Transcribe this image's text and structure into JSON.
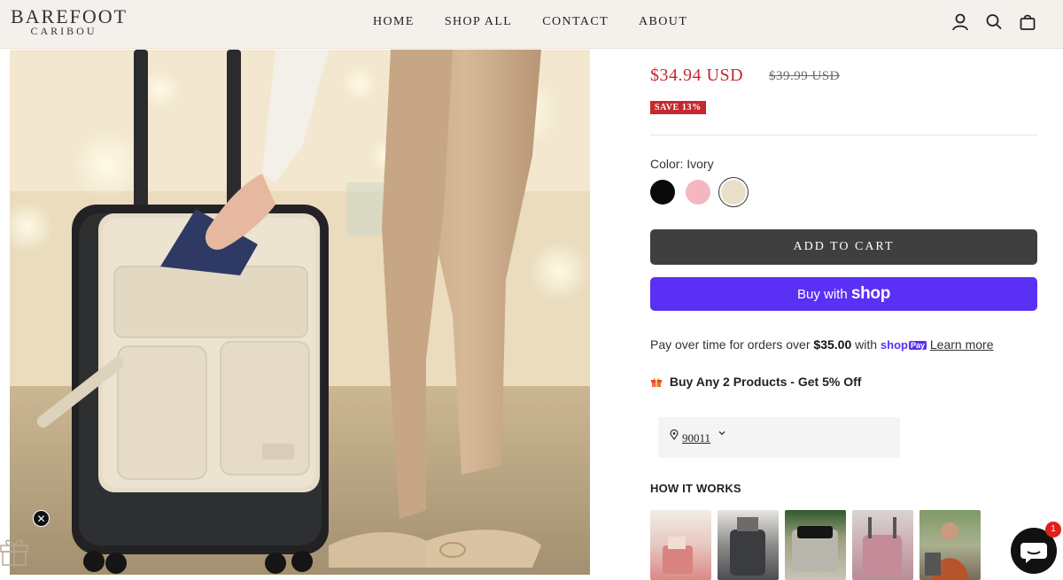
{
  "brand": {
    "line1": "BAREFOOT",
    "line2": "CARIBOU"
  },
  "nav": {
    "home": "HOME",
    "shop_all": "SHOP ALL",
    "contact": "CONTACT",
    "about": "ABOUT"
  },
  "product": {
    "price": "$34.94 USD",
    "compare_price": "$39.99 USD",
    "save_badge": "SAVE 13%",
    "color_label": "Color: Ivory",
    "swatches": [
      {
        "name": "Black",
        "color": "#0a0a0a"
      },
      {
        "name": "Pink",
        "color": "#f4b7c1"
      },
      {
        "name": "Ivory",
        "color": "#e9dfc8"
      }
    ],
    "selected_swatch": "Ivory",
    "add_to_cart": "ADD TO CART",
    "buy_with": "Buy with",
    "buy_with_brand": "shop"
  },
  "installments": {
    "prefix": "Pay over time for orders over",
    "amount": "$35.00",
    "with": "with",
    "brand": "shop",
    "badge": "Pay",
    "learn_more": "Learn more"
  },
  "promo": {
    "icon": "gift-icon",
    "text": "Buy Any 2 Products - Get 5% Off"
  },
  "delivery": {
    "zip": "90011"
  },
  "how_it_works": {
    "title": "HOW IT WORKS",
    "thumbs": [
      {
        "icon": "video-thumbnail-1",
        "color": "#d98a86"
      },
      {
        "icon": "video-thumbnail-2",
        "color": "#4d4d52"
      },
      {
        "icon": "video-thumbnail-3",
        "color": "#b8b3a6"
      },
      {
        "icon": "video-thumbnail-4",
        "color": "#c89aa3"
      },
      {
        "icon": "video-thumbnail-5",
        "color": "#7a8a6c"
      }
    ]
  },
  "chat": {
    "badge": "1"
  },
  "colors": {
    "price_red": "#c6282f",
    "shop_purple": "#5a31f4",
    "cart_dark": "#3f3f3f",
    "header_bg": "#f4f1ec"
  }
}
